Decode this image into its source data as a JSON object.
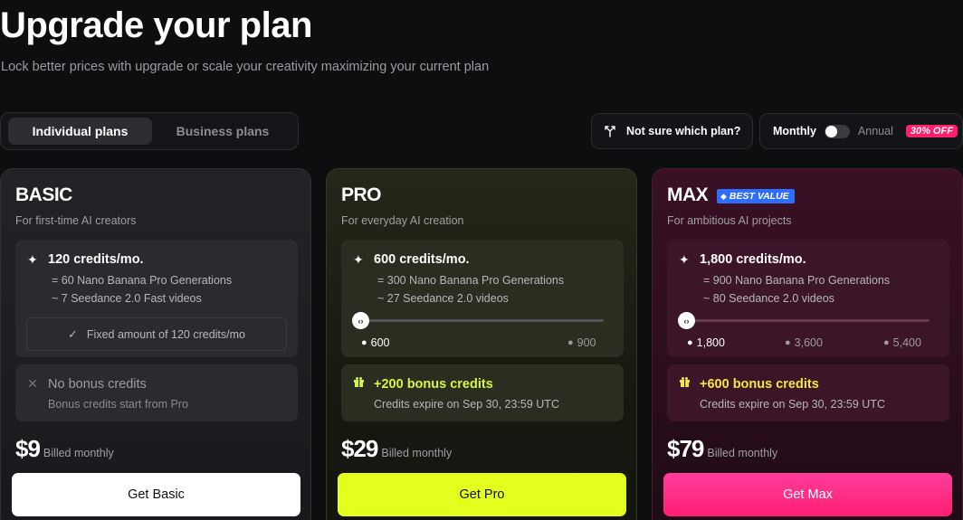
{
  "header": {
    "title": "Upgrade your plan",
    "subtitle": "Lock better prices with upgrade or scale your creativity maximizing your current plan"
  },
  "plan_type": {
    "tabs": [
      {
        "label": "Individual plans",
        "active": true
      },
      {
        "label": "Business plans",
        "active": false
      }
    ]
  },
  "help": {
    "label": "Not sure which plan?",
    "icon": "route-fork-icon"
  },
  "billing": {
    "monthly_label": "Monthly",
    "annual_label": "Annual",
    "discount": "30% OFF",
    "annual_selected": false
  },
  "plans": [
    {
      "name": "BASIC",
      "tagline": "For first-time AI creators",
      "credits": "120 credits/mo.",
      "line1": "= 60 Nano Banana Pro Generations",
      "line2": "~ 7 Seedance 2.0 Fast videos",
      "fixed_note": "Fixed amount of 120 credits/mo",
      "bonus_title": "No bonus credits",
      "bonus_sub": "Bonus credits start from Pro",
      "price": "$9",
      "price_note": "Billed monthly",
      "cta": "Get Basic",
      "accent": "#ffffff"
    },
    {
      "name": "PRO",
      "tagline": "For everyday AI creation",
      "credits": "600 credits/mo.",
      "line1": "= 300 Nano Banana Pro Generations",
      "line2": "~ 27 Seedance 2.0 videos",
      "slider_options": [
        "600",
        "900"
      ],
      "slider_selected": "600",
      "bonus_title": "+200 bonus credits",
      "bonus_sub": "Credits expire on Sep 30, 23:59 UTC",
      "price": "$29",
      "price_note": "Billed monthly",
      "cta": "Get Pro",
      "accent": "#e3ff1e"
    },
    {
      "name": "MAX",
      "badge": "BEST VALUE",
      "tagline": "For ambitious AI projects",
      "credits": "1,800 credits/mo.",
      "line1": "= 900 Nano Banana Pro Generations",
      "line2": "~ 80 Seedance 2.0 videos",
      "slider_options": [
        "1,800",
        "3,600",
        "5,400"
      ],
      "slider_selected": "1,800",
      "bonus_title": "+600 bonus credits",
      "bonus_sub": "Credits expire on Sep 30, 23:59 UTC",
      "price": "$79",
      "price_note": "Billed monthly",
      "cta": "Get Max",
      "accent": "#ff2a85"
    }
  ]
}
